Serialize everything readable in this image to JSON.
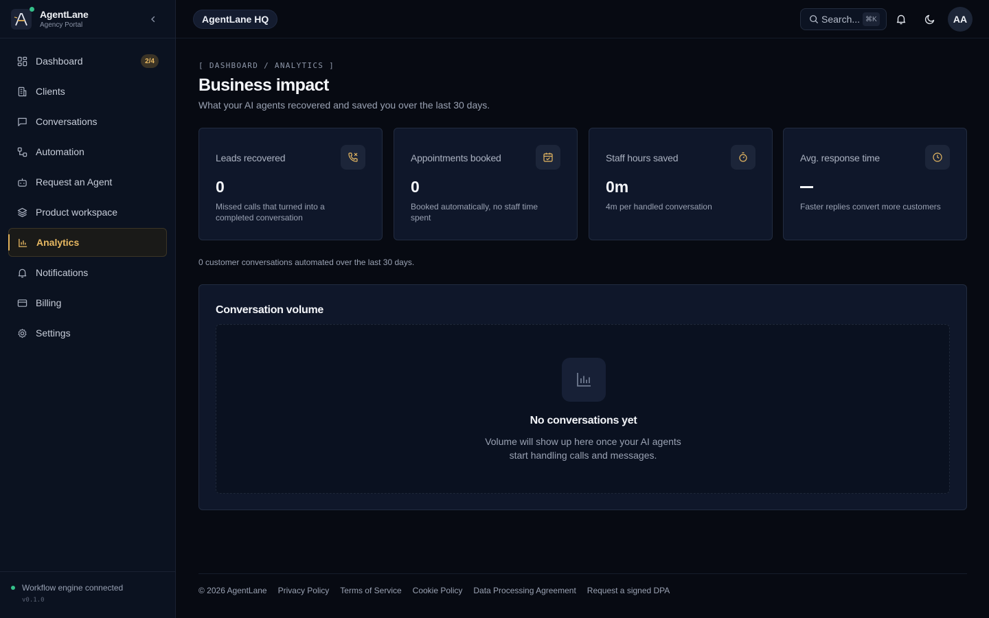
{
  "brand": {
    "name": "AgentLane",
    "subtitle": "Agency Portal"
  },
  "sidebar": {
    "items": [
      {
        "label": "Dashboard",
        "icon": "grid-icon",
        "badge": "2/4"
      },
      {
        "label": "Clients",
        "icon": "building-icon"
      },
      {
        "label": "Conversations",
        "icon": "chat-icon"
      },
      {
        "label": "Automation",
        "icon": "workflow-icon"
      },
      {
        "label": "Request an Agent",
        "icon": "bot-icon"
      },
      {
        "label": "Product workspace",
        "icon": "layers-icon"
      },
      {
        "label": "Analytics",
        "icon": "bar-chart-icon",
        "active": true
      },
      {
        "label": "Notifications",
        "icon": "bell-icon"
      },
      {
        "label": "Billing",
        "icon": "credit-card-icon"
      },
      {
        "label": "Settings",
        "icon": "gear-icon"
      }
    ],
    "status": "Workflow engine connected",
    "version": "v0.1.0"
  },
  "topbar": {
    "org": "AgentLane HQ",
    "search_placeholder": "Search...",
    "search_shortcut": "⌘K",
    "avatar_initials": "AA"
  },
  "page": {
    "breadcrumb": "[ DASHBOARD / ANALYTICS ]",
    "title": "Business impact",
    "subtitle": "What your AI agents recovered and saved you over the last 30 days."
  },
  "stats": [
    {
      "label": "Leads recovered",
      "value": "0",
      "description": "Missed calls that turned into a completed conversation",
      "icon": "phone-missed-icon"
    },
    {
      "label": "Appointments booked",
      "value": "0",
      "description": "Booked automatically, no staff time spent",
      "icon": "calendar-check-icon"
    },
    {
      "label": "Staff hours saved",
      "value": "0m",
      "description": "4m per handled conversation",
      "icon": "timer-icon"
    },
    {
      "label": "Avg. response time",
      "value": "—",
      "description": "Faster replies convert more customers",
      "icon": "clock-icon"
    }
  ],
  "summary": "0 customer conversations automated over the last 30 days.",
  "volume": {
    "title": "Conversation volume",
    "empty_title": "No conversations yet",
    "empty_text": "Volume will show up here once your AI agents start handling calls and messages."
  },
  "footer": {
    "links": [
      "© 2026 AgentLane",
      "Privacy Policy",
      "Terms of Service",
      "Cookie Policy",
      "Data Processing Agreement",
      "Request a signed DPA"
    ]
  },
  "colors": {
    "accent": "#e8b962",
    "status_ok": "#34c08a",
    "background": "#070a12",
    "card": "#0f172a"
  }
}
